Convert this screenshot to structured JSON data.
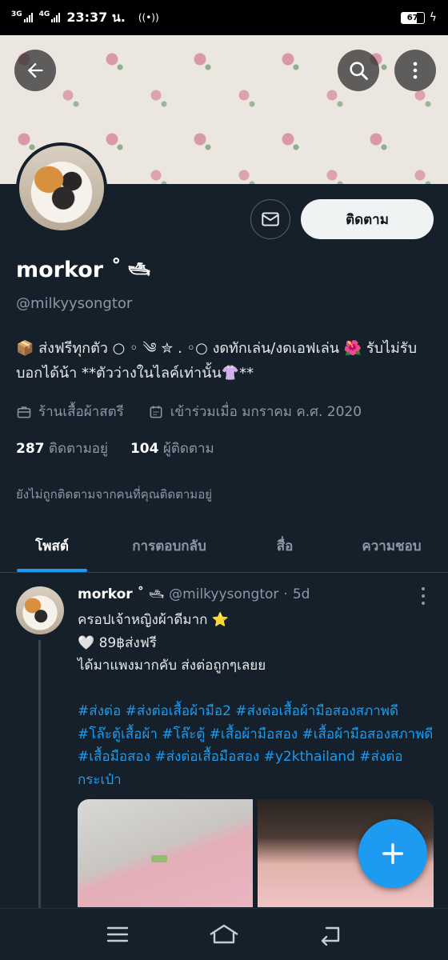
{
  "status_bar": {
    "network1": "3G",
    "network2": "4G",
    "time": "23:37 น.",
    "battery": "67"
  },
  "profile": {
    "name": "morkor ˚",
    "name_emoji": "🛥",
    "handle": "@milkyysongtor",
    "bio": "📦 ส่งฟรีทุกตัว ○ ◦ ༄ ✮ . ◦○ งดทักเล่น/งดเอฟเล่น 🌺 รับไม่รับบอกได้น้า **ตัวว่างในไลค์เท่านั้น👚**",
    "category": "ร้านเสื้อผ้าสตรี",
    "joined": "เข้าร่วมเมื่อ มกราคม ค.ศ. 2020",
    "following_count": "287",
    "following_label": "ติดตามอยู่",
    "followers_count": "104",
    "followers_label": "ผู้ติดตาม",
    "not_followed_note": "ยังไม่ถูกติดตามจากคนที่คุณติดตามอยู่",
    "follow_button": "ติดตาม"
  },
  "tabs": [
    {
      "label": "โพสต์",
      "active": true
    },
    {
      "label": "การตอบกลับ",
      "active": false
    },
    {
      "label": "สื่อ",
      "active": false
    },
    {
      "label": "ความชอบ",
      "active": false
    }
  ],
  "tweet": {
    "name": "morkor ˚",
    "handle": "@milkyysongtor",
    "dot": "·",
    "time": "5d",
    "line1": "ครอปเจ้าหญิงผ้าดีมาก ⭐",
    "line2": "🤍 89฿ส่งฟรี",
    "line3": "ได้มาแพงมากคับ ส่งต่อถูกๆเลยย",
    "hashtags": "#ส่งต่อ #ส่งต่อเสื้อผ้ามือ2 #ส่งต่อเสื้อผ้ามือสองสภาพดี #โล๊ะตู้เสื้อผ้า #โล๊ะตู้ #เสื้อผ้ามือสอง #เสื้อผ้ามือสองสภาพดี #เสื้อมือสอง #ส่งต่อเสื้อมือสอง #y2kthailand #ส่งต่อกระเป๋า"
  },
  "colors": {
    "background": "#15202b",
    "accent": "#1d9bf0",
    "secondary_text": "#8b98a5"
  },
  "icons": [
    "back-arrow-icon",
    "search-icon",
    "more-vertical-icon",
    "envelope-icon",
    "briefcase-icon",
    "calendar-icon",
    "plus-icon",
    "menu-icon",
    "home-icon",
    "back-icon"
  ]
}
